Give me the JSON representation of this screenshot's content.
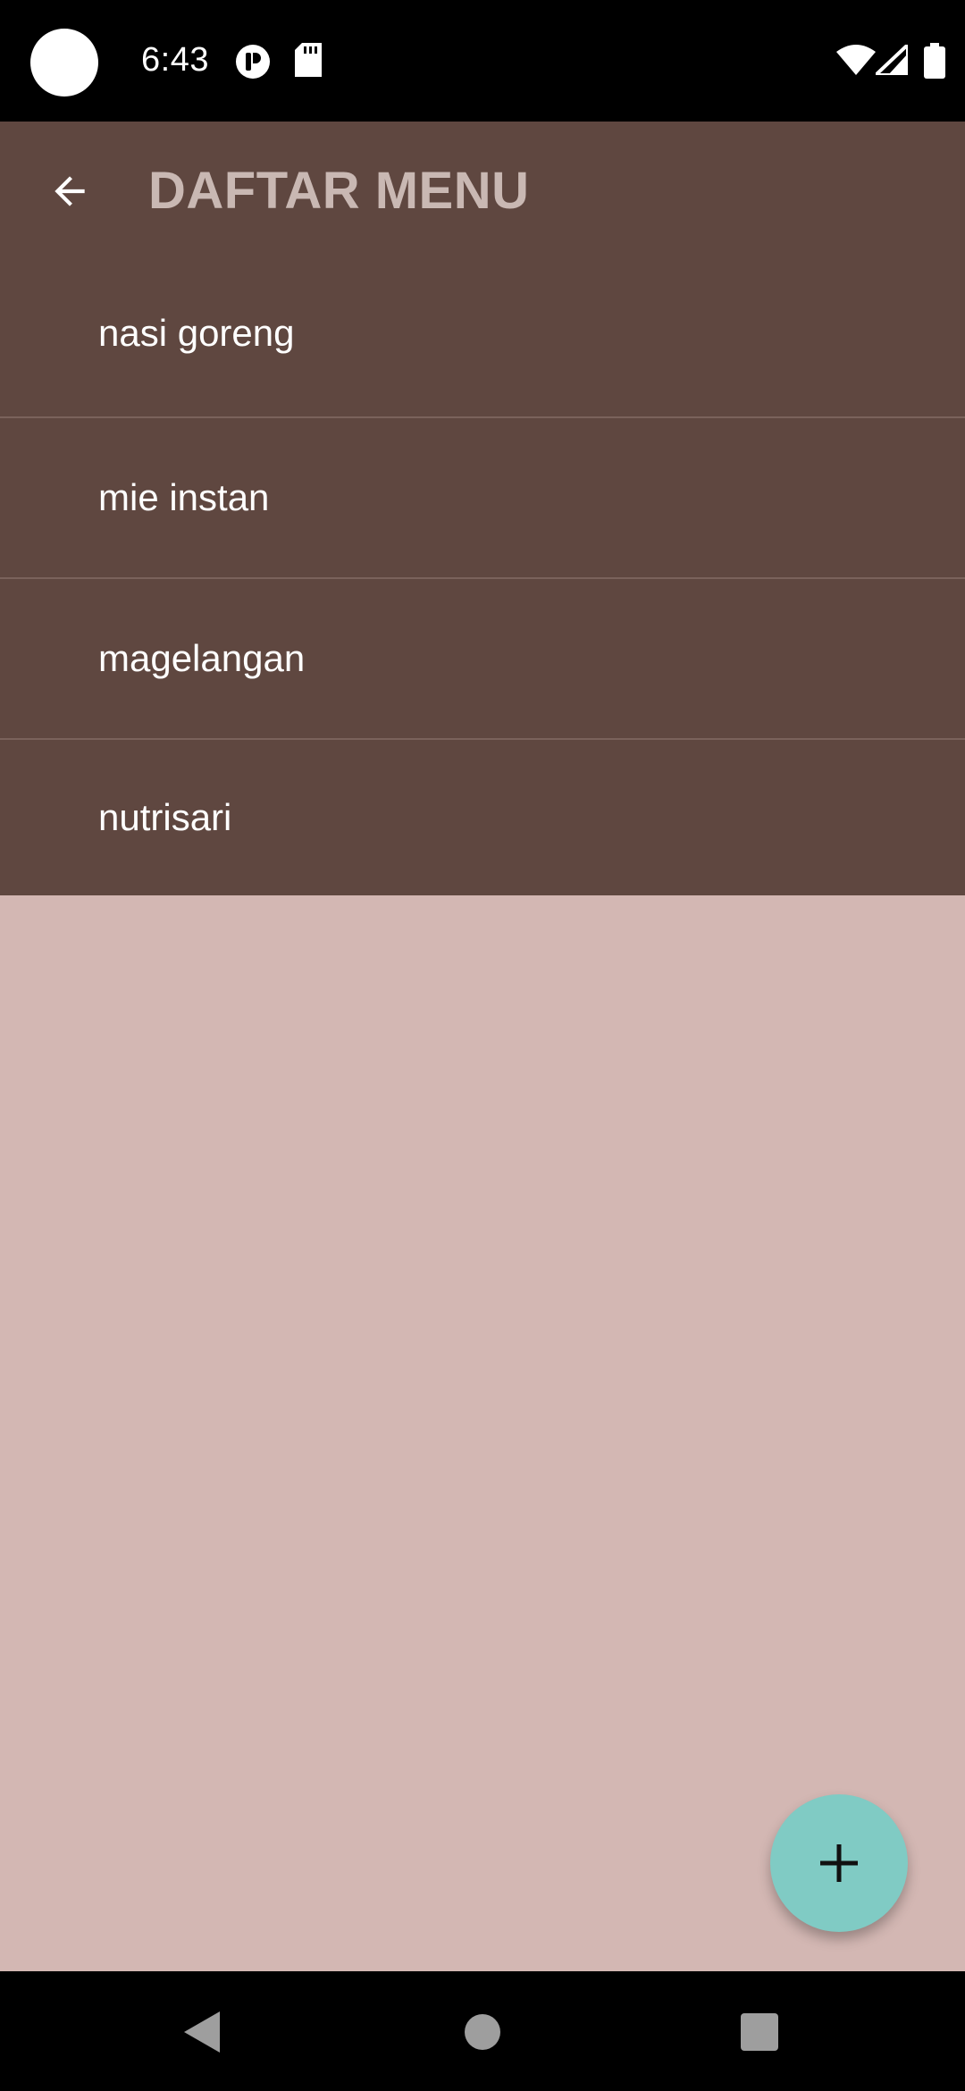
{
  "status_bar": {
    "time": "6:43",
    "icons": [
      "camera-hole",
      "notification-app-icon",
      "sd-card-icon",
      "wifi-icon",
      "signal-icon",
      "battery-icon"
    ]
  },
  "app_bar": {
    "title": "DAFTAR MENU",
    "back_icon": "arrow-back-icon"
  },
  "menu": {
    "items": [
      {
        "label": "nasi goreng"
      },
      {
        "label": "mie instan"
      },
      {
        "label": "magelangan"
      },
      {
        "label": "nutrisari"
      }
    ]
  },
  "fab": {
    "icon": "plus-icon"
  },
  "nav_bar": {
    "buttons": [
      "back-triangle-icon",
      "home-circle-icon",
      "recents-square-icon"
    ]
  },
  "colors": {
    "app_bar": "#5f4740",
    "list_background": "#5f4740",
    "content_background": "#d3b7b3",
    "title_text": "#c9b8b3",
    "fab": "#80cbc4",
    "divider": "#7a625b"
  }
}
